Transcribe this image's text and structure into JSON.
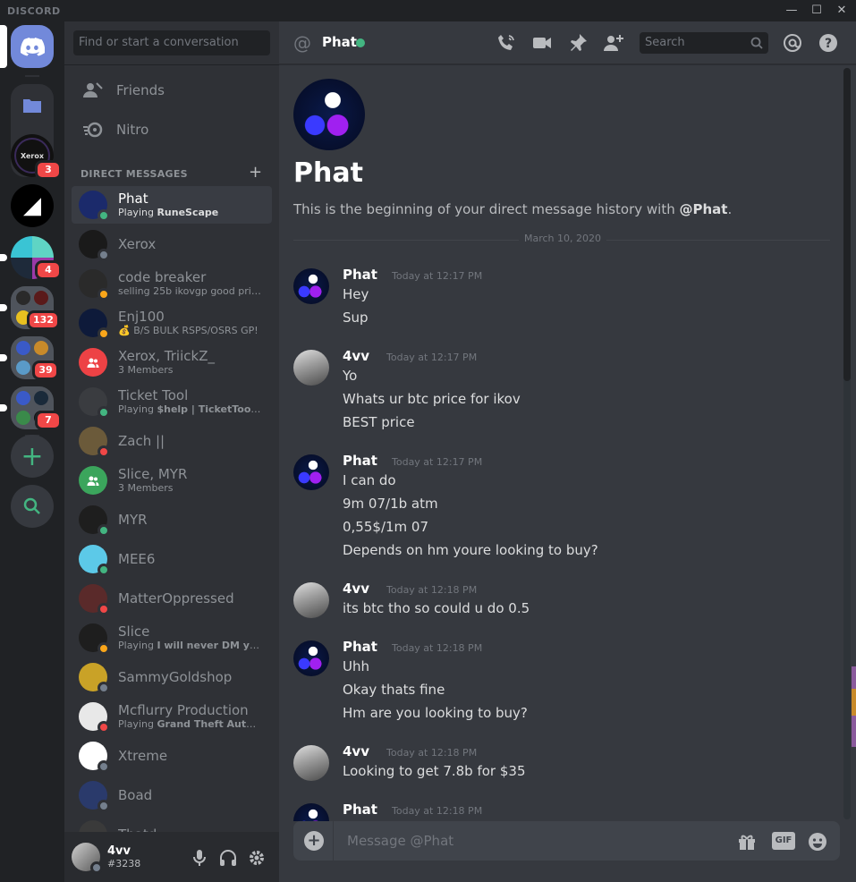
{
  "app": {
    "brand": "DISCORD",
    "minimize": "—",
    "maximize": "☐",
    "close": "✕"
  },
  "servers": [
    {
      "name": "Home",
      "icon": "discord-logo-icon"
    },
    {
      "name": "Folder",
      "icon": "folder-icon"
    },
    {
      "name": "Xerox",
      "label": "Xerox",
      "badge": "3"
    },
    {
      "name": "Dark server",
      "label": "◢"
    },
    {
      "name": "TT server",
      "badge": "4"
    },
    {
      "name": "Server group 1",
      "badge": "132"
    },
    {
      "name": "Server group 2",
      "badge": "39"
    },
    {
      "name": "Server group 3",
      "badge": "7"
    }
  ],
  "rail": {
    "add": "+",
    "explore": "explore-icon"
  },
  "sidebar": {
    "search_placeholder": "Find or start a conversation",
    "friends_label": "Friends",
    "nitro_label": "Nitro",
    "dm_header": "DIRECT MESSAGES",
    "dm_add": "+",
    "dms": [
      {
        "name": "Phat",
        "sub_prefix": "Playing ",
        "sub_bold": "RuneScape",
        "status": "online",
        "color": "#1b2a6b"
      },
      {
        "name": "Xerox",
        "sub_prefix": "",
        "sub_bold": "",
        "status": "offline",
        "color": "#1a1a1a"
      },
      {
        "name": "code breaker",
        "sub_prefix": "selling 25b ikovgp good price...",
        "sub_bold": "",
        "status": "idle",
        "color": "#2a2a2a"
      },
      {
        "name": "Enj100",
        "sub_prefix": "💰 B/S BULK RSPS/OSRS GP!",
        "sub_bold": "",
        "status": "idle",
        "color": "#0e1a3a"
      },
      {
        "name": "Xerox, TriickZ_",
        "sub_prefix": "3 Members",
        "sub_bold": "",
        "status": "",
        "color": "#ed4245"
      },
      {
        "name": "Ticket Tool",
        "sub_prefix": "Playing ",
        "sub_bold": "$help | TicketTool.xy...",
        "status": "online",
        "color": "#3a3c40"
      },
      {
        "name": "Zach ||",
        "sub_prefix": "",
        "sub_bold": "",
        "status": "dnd",
        "color": "#6b5a3a"
      },
      {
        "name": "Slice, MYR",
        "sub_prefix": "3 Members",
        "sub_bold": "",
        "status": "",
        "color": "#3ba55c"
      },
      {
        "name": "MYR",
        "sub_prefix": "",
        "sub_bold": "",
        "status": "online",
        "color": "#1e1e1e"
      },
      {
        "name": "MEE6",
        "sub_prefix": "",
        "sub_bold": "",
        "status": "online",
        "color": "#5cc9e8"
      },
      {
        "name": "MatterOppressed",
        "sub_prefix": "",
        "sub_bold": "",
        "status": "dnd",
        "color": "#5a2a2a"
      },
      {
        "name": "Slice",
        "sub_prefix": "Playing ",
        "sub_bold": "I will never DM you fi...",
        "status": "idle",
        "color": "#1e1e1e"
      },
      {
        "name": "SammyGoldshop",
        "sub_prefix": "",
        "sub_bold": "",
        "status": "offline",
        "color": "#c9a227"
      },
      {
        "name": "Mcflurry Production",
        "sub_prefix": "Playing ",
        "sub_bold": "Grand Theft Auto Sa...",
        "status": "dnd",
        "color": "#e8e8e8"
      },
      {
        "name": "Xtreme",
        "sub_prefix": "",
        "sub_bold": "",
        "status": "offline",
        "color": "#ffffff"
      },
      {
        "name": "Boad",
        "sub_prefix": "",
        "sub_bold": "",
        "status": "offline",
        "color": "#2a3a6b"
      },
      {
        "name": "Thatd...",
        "sub_prefix": "",
        "sub_bold": "",
        "status": "offline",
        "color": "#3a3a3a"
      }
    ]
  },
  "user": {
    "name": "4vv",
    "tag": "#3238"
  },
  "chat": {
    "at_symbol": "@",
    "name": "Phat",
    "search_placeholder": "Search",
    "intro_name": "Phat",
    "intro_text": "This is the beginning of your direct message history with ",
    "intro_mention": "@Phat",
    "intro_end": ".",
    "date_divider": "March 10, 2020",
    "groups": [
      {
        "author": "Phat",
        "time": "Today at 12:17 PM",
        "lines": [
          "Hey",
          "Sup"
        ]
      },
      {
        "author": "4vv",
        "time": "Today at 12:17 PM",
        "lines": [
          "Yo",
          "Whats ur btc price for ikov",
          "BEST price"
        ]
      },
      {
        "author": "Phat",
        "time": "Today at 12:17 PM",
        "lines": [
          "I can do",
          "9m 07/1b atm",
          "0,55$/1m 07",
          "Depends on hm youre looking to buy?"
        ]
      },
      {
        "author": "4vv",
        "time": "Today at 12:18 PM",
        "lines": [
          "its btc tho so could u do 0.5"
        ]
      },
      {
        "author": "Phat",
        "time": "Today at 12:18 PM",
        "lines": [
          "Uhh",
          "Okay thats fine",
          "Hm are you looking to buy?"
        ]
      },
      {
        "author": "4vv",
        "time": "Today at 12:18 PM",
        "lines": [
          "Looking to get 7.8b for $35"
        ]
      },
      {
        "author": "Phat",
        "time": "Today at 12:18 PM",
        "lines": []
      }
    ],
    "composer_placeholder": "Message @Phat",
    "composer_plus": "+",
    "gif_label": "GIF"
  }
}
